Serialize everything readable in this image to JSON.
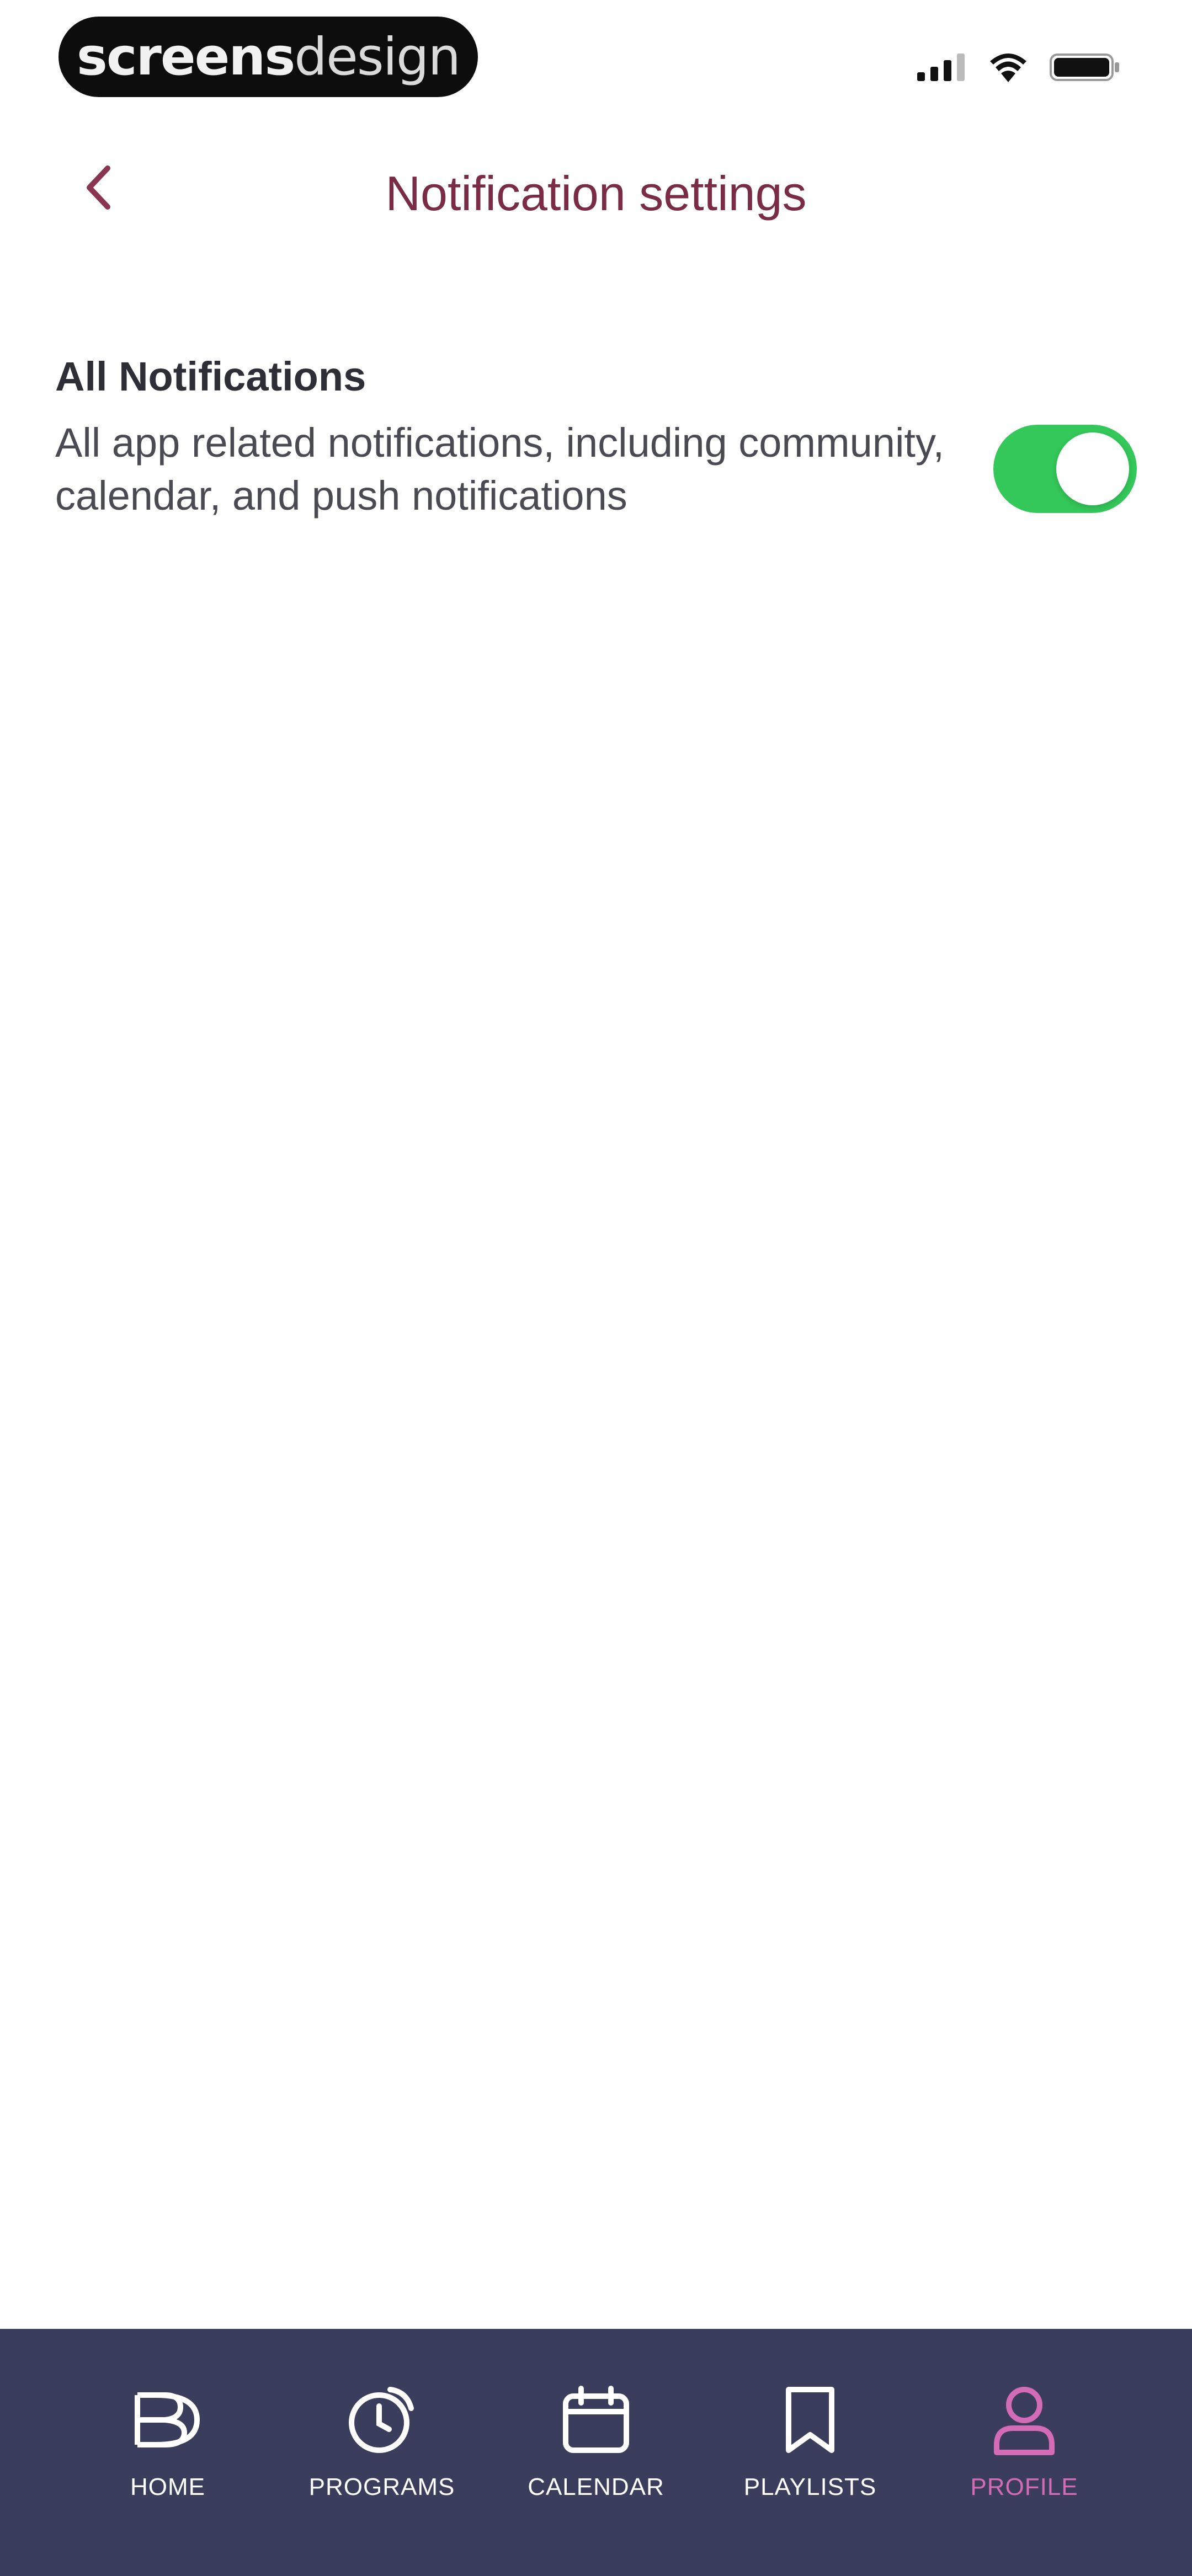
{
  "status_bar": {
    "brand_bold": "screens",
    "brand_light": "design",
    "signal_icon": "signal-icon",
    "wifi_icon": "wifi-icon",
    "battery_icon": "battery-icon"
  },
  "header": {
    "back_icon": "chevron-left-icon",
    "title": "Notification settings"
  },
  "settings": {
    "all_notifications": {
      "title": "All Notifications",
      "description": "All app related notifications, including community, calendar, and push notifications",
      "enabled": true
    }
  },
  "tab_bar": {
    "items": [
      {
        "label": "HOME",
        "icon": "home-logo-icon",
        "active": false
      },
      {
        "label": "PROGRAMS",
        "icon": "programs-icon",
        "active": false
      },
      {
        "label": "CALENDAR",
        "icon": "calendar-icon",
        "active": false
      },
      {
        "label": "PLAYLISTS",
        "icon": "bookmark-icon",
        "active": false
      },
      {
        "label": "PROFILE",
        "icon": "profile-icon",
        "active": true
      }
    ]
  },
  "colors": {
    "title": "#7a2b45",
    "toggle_on": "#34c759",
    "tab_bar_bg": "#3a3d5c",
    "tab_active": "#d36bb6"
  }
}
